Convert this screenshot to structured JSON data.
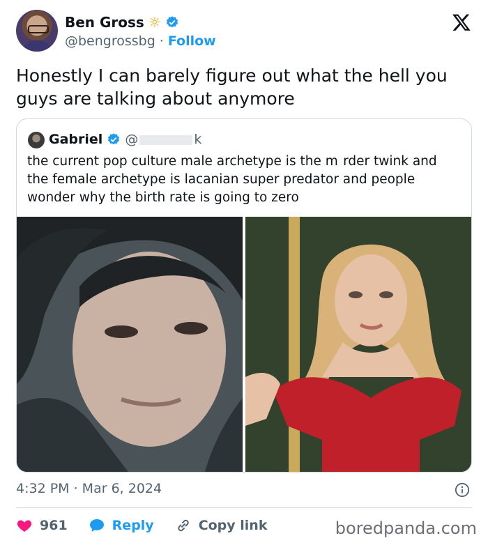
{
  "author": {
    "name": "Ben Gross",
    "handle": "@bengrossbg",
    "separator": "·",
    "follow_label": "Follow"
  },
  "tweet": {
    "text": "Honestly I can barely figure out what the hell you guys are talking about anymore"
  },
  "quoted": {
    "name": "Gabriel",
    "handle_start": "@",
    "handle_end": "k",
    "text": "the current pop culture male archetype is the m  rder twink and the female archetype is lacanian super predator and people wonder why the birth rate is going to zero"
  },
  "meta": {
    "timestamp": "4:32 PM · Mar 6, 2024"
  },
  "actions": {
    "like_count": "961",
    "reply_label": "Reply",
    "copy_label": "Copy link"
  },
  "watermark": "boredpanda.com",
  "colors": {
    "accent": "#1d9bf0",
    "like": "#f91880",
    "secondary_text": "#536471"
  }
}
